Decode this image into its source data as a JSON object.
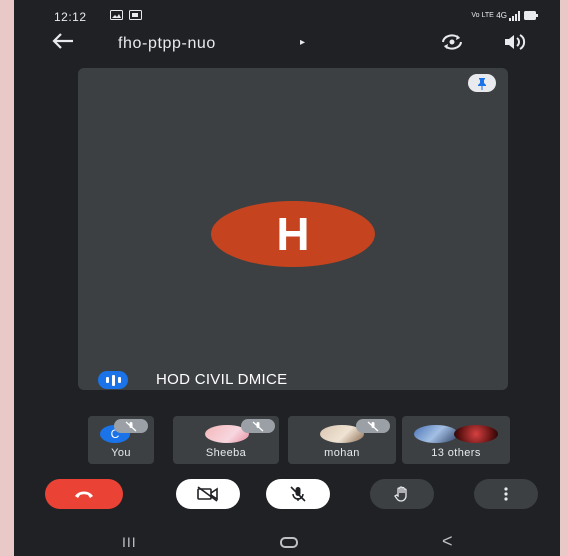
{
  "status_bar": {
    "time": "12:12",
    "left_icons": [
      "gallery-icon",
      "cast-icon"
    ],
    "right_icons": [
      "volte-icon",
      "4g-icon",
      "signal-icon",
      "battery-icon"
    ],
    "right_text": "Vo LTE 4G"
  },
  "header": {
    "back_icon": "arrow-left-icon",
    "meeting_code": "fho-ptpp-nuo",
    "caret": "▸",
    "switch_camera_icon": "switch-camera-icon",
    "speaker_icon": "speaker-icon"
  },
  "main_tile": {
    "pin_icon": "pin-icon",
    "avatar_letter": "H",
    "avatar_color": "#c5441f",
    "speaking_icon": "speaking-indicator-icon",
    "participant_name": "HOD CIVIL DMICE"
  },
  "participants": [
    {
      "label": "You",
      "avatar_letter": "C",
      "avatar_color": "#1a73e8",
      "muted": true
    },
    {
      "label": "Sheeba",
      "muted": true
    },
    {
      "label": "mohan",
      "muted": true
    },
    {
      "label": "13 others",
      "muted": false
    }
  ],
  "controls": {
    "end_call_icon": "end-call-icon",
    "camera_off_icon": "camera-off-icon",
    "mic_off_icon": "mic-off-icon",
    "raise_hand_icon": "raise-hand-icon",
    "more_icon": "more-vertical-icon"
  },
  "nav_bar": {
    "recents": "III",
    "back": "<"
  },
  "colors": {
    "background": "#202124",
    "tile": "#3c4043",
    "end_call": "#ea4335",
    "accent": "#1a73e8"
  }
}
